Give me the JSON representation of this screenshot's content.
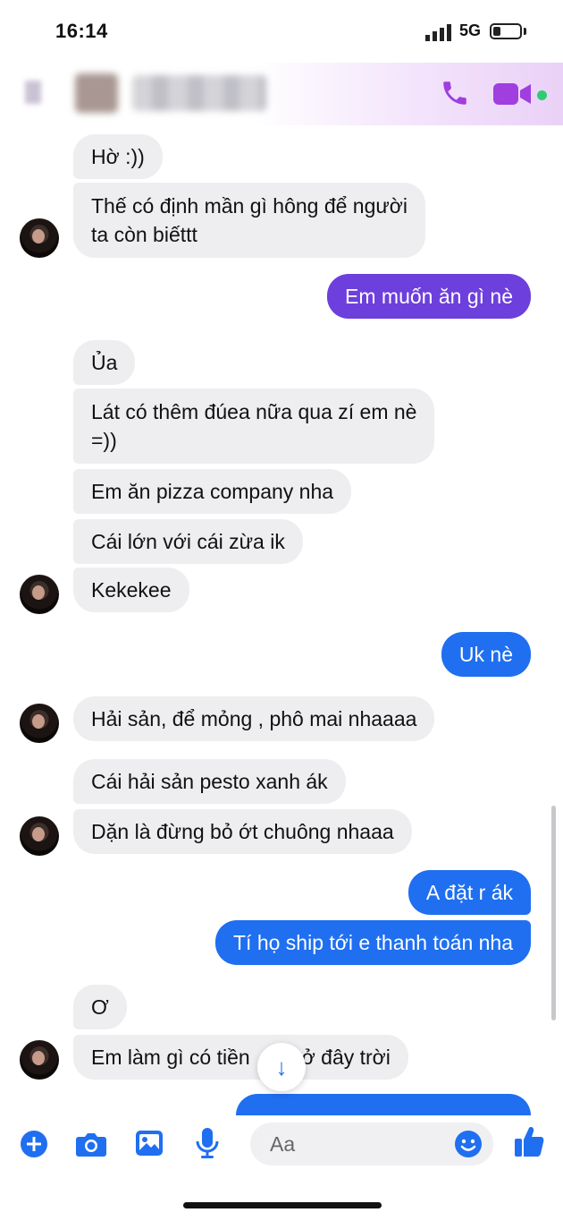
{
  "status": {
    "time": "16:14",
    "network": "5G"
  },
  "colors": {
    "outgoing_purple": "#6d3fdc",
    "outgoing_blue": "#1f6ff0",
    "incoming_bg": "#eeeef0",
    "accent": "#a03ee0"
  },
  "header": {
    "icons": [
      "phone-icon",
      "video-call-icon"
    ]
  },
  "messages": [
    {
      "dir": "in",
      "text": "Hờ :))"
    },
    {
      "dir": "in",
      "text": "Thế có định mần gì hông để người",
      "text2": "ta còn biếttt"
    },
    {
      "dir": "out",
      "text": "Em muốn ăn gì nè"
    },
    {
      "dir": "in",
      "text": "Ủa"
    },
    {
      "dir": "in",
      "text": "Lát có thêm đúea nữa qua zí em nè",
      "text2": "=))"
    },
    {
      "dir": "in",
      "text": "Em ăn pizza company nha"
    },
    {
      "dir": "in",
      "text": "Cái lớn với cái zừa ik"
    },
    {
      "dir": "in",
      "text": "Kekekee"
    },
    {
      "dir": "out",
      "text": "Uk nè"
    },
    {
      "dir": "in",
      "text": "Hải sản, để mỏng , phô mai nhaaaa"
    },
    {
      "dir": "in",
      "text": "Cái hải sản pesto xanh ák"
    },
    {
      "dir": "in",
      "text": "Dặn là đừng bỏ ớt chuông nhaaa"
    },
    {
      "dir": "out",
      "text": "A đặt r ák"
    },
    {
      "dir": "out",
      "text": "Tí họ ship tới e thanh toán nha"
    },
    {
      "dir": "in",
      "text": "Ơ"
    },
    {
      "dir": "in",
      "text": "Em làm gì có tiền",
      "text_after": "ở đây trời"
    }
  ],
  "composer": {
    "placeholder": "Aa"
  }
}
